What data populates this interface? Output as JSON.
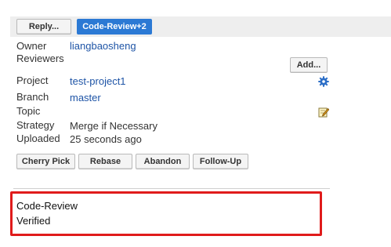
{
  "toolbar": {
    "reply_label": "Reply...",
    "code_review_label": "Code-Review+2"
  },
  "info": {
    "owner_label": "Owner",
    "owner_value": "liangbaosheng",
    "reviewers_label": "Reviewers",
    "add_reviewer_label": "Add...",
    "project_label": "Project",
    "project_value": "test-project1",
    "branch_label": "Branch",
    "branch_value": "master",
    "topic_label": "Topic",
    "strategy_label": "Strategy",
    "strategy_value": "Merge if Necessary",
    "uploaded_label": "Uploaded",
    "uploaded_value": "25 seconds ago"
  },
  "actions": {
    "cherry_pick_label": "Cherry Pick",
    "rebase_label": "Rebase",
    "abandon_label": "Abandon",
    "follow_up_label": "Follow-Up"
  },
  "labels": {
    "items": [
      {
        "name": "Code-Review"
      },
      {
        "name": "Verified"
      }
    ]
  },
  "icons": {
    "project_settings": "gear-icon",
    "topic_edit": "edit-icon"
  },
  "colors": {
    "primary_button": "#2b79d4",
    "link": "#1e54a6",
    "highlight_border": "#e01b1b",
    "toolbar_bg": "#eeeeee"
  }
}
